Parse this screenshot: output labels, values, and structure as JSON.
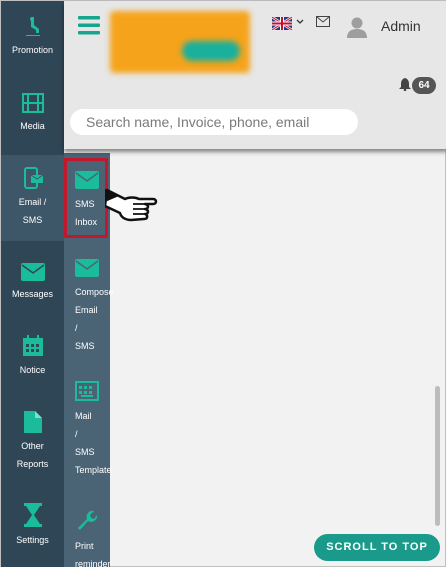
{
  "sidebar": {
    "items": [
      {
        "label": "Promotion",
        "icon": "promotion-icon"
      },
      {
        "label": "Media",
        "icon": "film-icon"
      },
      {
        "label": "Email /\nSMS",
        "icon": "mobile-mail-icon"
      },
      {
        "label": "Messages",
        "icon": "envelope-icon"
      },
      {
        "label": "Notice",
        "icon": "calendar-icon"
      },
      {
        "label": "Other\nReports",
        "icon": "file-icon"
      },
      {
        "label": "Settings",
        "icon": "hourglass-icon"
      }
    ]
  },
  "subbar": {
    "items": [
      {
        "label": "SMS\nInbox",
        "icon": "envelope-icon"
      },
      {
        "label": "Compose\nEmail\n/\nSMS",
        "icon": "envelope-icon"
      },
      {
        "label": "Mail\n/\nSMS\nTemplate",
        "icon": "keyboard-icon"
      },
      {
        "label": "Print\nreminder",
        "icon": "wrench-icon"
      }
    ]
  },
  "header": {
    "user_name": "Admin",
    "notification_count": "64",
    "search_placeholder": "Search name, Invoice, phone, email",
    "language_flag": "uk-flag-icon"
  },
  "scroll_top_label": "SCROLL TO TOP",
  "colors": {
    "sidebar_bg": "#2f4656",
    "subbar_bg": "#4a6476",
    "accent": "#1abc9c",
    "highlight": "#c2182b",
    "scroll_button": "#1a9a8a"
  }
}
